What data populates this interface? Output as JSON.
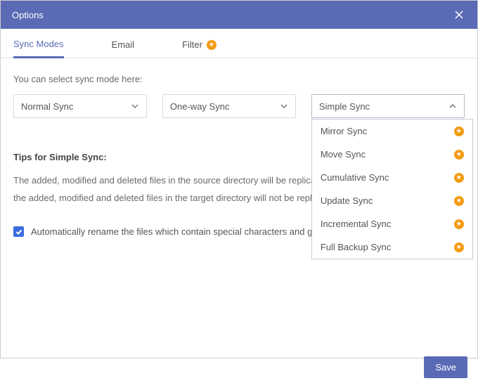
{
  "window": {
    "title": "Options"
  },
  "tabs": {
    "sync_modes": "Sync Modes",
    "email": "Email",
    "filter": "Filter"
  },
  "hint": "You can select sync mode here:",
  "selects": {
    "a": "Normal Sync",
    "b": "One-way Sync",
    "c": "Simple Sync"
  },
  "dropdown": {
    "items": [
      {
        "label": "Mirror Sync"
      },
      {
        "label": "Move Sync"
      },
      {
        "label": "Cumulative Sync"
      },
      {
        "label": "Update Sync"
      },
      {
        "label": "Incremental Sync"
      },
      {
        "label": "Full Backup Sync"
      }
    ]
  },
  "tips": {
    "title": "Tips for Simple Sync:",
    "body": "The added, modified and deleted files in the source directory will be replicated to the target directory. However, the added, modified and deleted files in the target directory will not be replicated to the source directory."
  },
  "checkbox": {
    "label": "Automatically rename the files which contain special characters and generate a script file."
  },
  "footer": {
    "save": "Save"
  }
}
